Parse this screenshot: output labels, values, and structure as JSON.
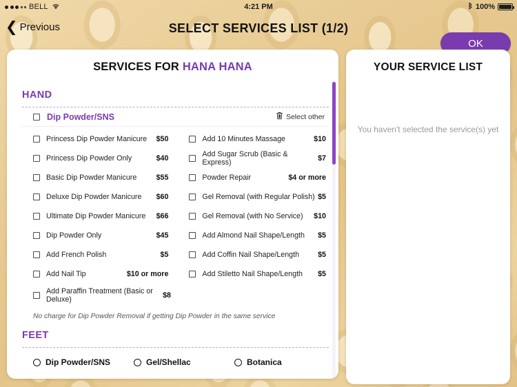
{
  "status_bar": {
    "carrier": "BELL",
    "signal_filled": 3,
    "signal_empty": 2,
    "wifi_icon": "wifi-icon",
    "time": "4:21 PM",
    "bluetooth_icon": "bluetooth-icon",
    "battery_percent": "100%",
    "battery_level": 100
  },
  "navbar": {
    "back_label": "Previous",
    "back_icon": "chevron-left-icon",
    "title": "SELECT SERVICES LIST (1/2)",
    "ok_label": "OK",
    "ok_color": "#7a3bae"
  },
  "left_panel": {
    "title_prefix": "SERVICES FOR ",
    "title_client": "HANA HANA",
    "section_hand": "HAND",
    "category": {
      "name": "Dip Powder/SNS",
      "select_other_label": "Select other",
      "trash_icon": "trash-icon"
    },
    "rows": [
      {
        "l_name": "Princess Dip Powder Manicure",
        "l_price": "$50",
        "r_name": "Add 10 Minutes Massage",
        "r_price": "$10"
      },
      {
        "l_name": "Princess Dip Powder Only",
        "l_price": "$40",
        "r_name": "Add Sugar Scrub (Basic & Express)",
        "r_price": "$7"
      },
      {
        "l_name": "Basic Dip Powder Manicure",
        "l_price": "$55",
        "r_name": "Powder Repair",
        "r_price": "$4 or more"
      },
      {
        "l_name": "Deluxe Dip Powder Manicure",
        "l_price": "$60",
        "r_name": "Gel Removal (with Regular Polish)",
        "r_price": "$5"
      },
      {
        "l_name": "Ultimate Dip Powder Manicure",
        "l_price": "$66",
        "r_name": "Gel Removal (with No Service)",
        "r_price": "$10"
      },
      {
        "l_name": "Dip Powder Only",
        "l_price": "$45",
        "r_name": "Add Almond Nail Shape/Length",
        "r_price": "$5"
      },
      {
        "l_name": "Add French Polish",
        "l_price": "$5",
        "r_name": "Add Coffin Nail Shape/Length",
        "r_price": "$5"
      },
      {
        "l_name": "Add Nail Tip",
        "l_price": "$10 or more",
        "r_name": "Add Stiletto Nail Shape/Length",
        "r_price": "$5"
      },
      {
        "l_name": "Add Paraffin Treatment (Basic or Deluxe)",
        "l_price": "$8",
        "r_name": "",
        "r_price": ""
      }
    ],
    "note": "No charge for Dip Powder Removal if getting Dip Powder in the same service",
    "section_feet": "FEET",
    "feet_options": [
      "Dip Powder/SNS",
      "Gel/Shellac",
      "Botanica"
    ],
    "accent_color": "#7a3bae"
  },
  "right_panel": {
    "title": "YOUR SERVICE LIST",
    "empty_message": "You haven't selected the service(s) yet"
  }
}
